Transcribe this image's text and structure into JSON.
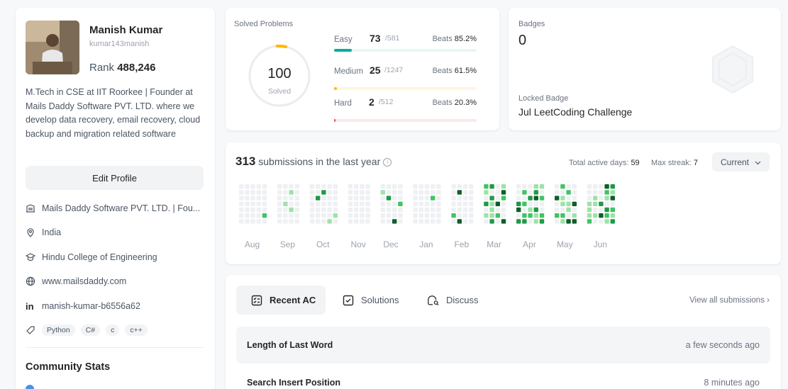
{
  "profile": {
    "name": "Manish Kumar",
    "username": "kumar143manish",
    "rank_label": "Rank",
    "rank_value": "488,246",
    "bio": "M.Tech in CSE at IIT Roorkee | Founder at Mails Daddy Software PVT. LTD. where we develop data recovery, email recovery, cloud backup and migration related software",
    "edit_label": "Edit Profile",
    "company": "Mails Daddy Software PVT. LTD. | Fou...",
    "location": "India",
    "school": "Hindu College of Engineering",
    "website": "www.mailsdaddy.com",
    "linkedin": "manish-kumar-b6556a62",
    "linkedin_icon_text": "in",
    "skills": [
      "Python",
      "C#",
      "c",
      "c++"
    ],
    "community_title": "Community Stats"
  },
  "solved": {
    "title": "Solved Problems",
    "total": "100",
    "total_label": "Solved",
    "difficulties": [
      {
        "name": "Easy",
        "count": "73",
        "total": "/581",
        "beats_label": "Beats",
        "beats": "85.2%",
        "fraction": 0.126,
        "color": "#00af9b",
        "track": "#e6f7f5"
      },
      {
        "name": "Medium",
        "count": "25",
        "total": "/1247",
        "beats_label": "Beats",
        "beats": "61.5%",
        "fraction": 0.02,
        "color": "#ffb800",
        "track": "#fff6e0"
      },
      {
        "name": "Hard",
        "count": "2",
        "total": "/512",
        "beats_label": "Beats",
        "beats": "20.3%",
        "fraction": 0.004,
        "color": "#ef4743",
        "track": "#fde8e8"
      }
    ]
  },
  "badges": {
    "title": "Badges",
    "count": "0",
    "locked_label": "Locked Badge",
    "locked_name": "Jul LeetCoding Challenge",
    "badge_icon": "locked-badge-hexagon"
  },
  "submissions": {
    "count": "313",
    "text": "submissions in the last year",
    "active_label": "Total active days:",
    "active_value": "59",
    "streak_label": "Max streak:",
    "streak_value": "7",
    "dropdown": "Current",
    "months": [
      "Aug",
      "Sep",
      "Oct",
      "Nov",
      "Dec",
      "Jan",
      "Feb",
      "Mar",
      "Apr",
      "May",
      "Jun"
    ],
    "colors": {
      "empty": "#eef0f3",
      "l1": "#9ee2a8",
      "l2": "#40c463",
      "l3": "#1f9a45",
      "l4": "#0f5e2a"
    }
  },
  "recent": {
    "tabs": [
      {
        "label": "Recent AC",
        "icon": "list-check-icon",
        "active": true
      },
      {
        "label": "Solutions",
        "icon": "checkbox-icon",
        "active": false
      },
      {
        "label": "Discuss",
        "icon": "chat-search-icon",
        "active": false
      }
    ],
    "view_all": "View all submissions",
    "items": [
      {
        "title": "Length of Last Word",
        "time": "a few seconds ago"
      },
      {
        "title": "Search Insert Position",
        "time": "8 minutes ago"
      }
    ]
  }
}
